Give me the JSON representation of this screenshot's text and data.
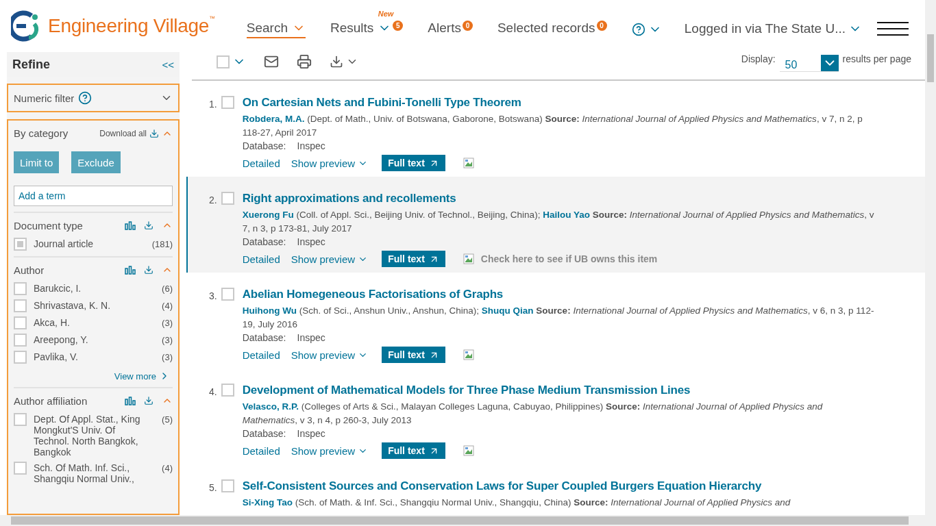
{
  "header": {
    "logo_text": "Engineering Village",
    "logo_mark": "™",
    "account": "Logged in via The State U...",
    "nav": [
      {
        "label": "Search",
        "selected": true
      },
      {
        "label": "Results",
        "selected": false,
        "tag": "New",
        "badge": "5"
      },
      {
        "label": "Alerts",
        "selected": false,
        "badge": "0"
      },
      {
        "label": "Selected records",
        "selected": false,
        "badge": "0"
      }
    ]
  },
  "toolbar": {
    "select_all_checked": false,
    "display_label": "Display:",
    "display_value": "50",
    "per_page": "results per page"
  },
  "sidebar": {
    "title": "Refine",
    "collapse": "<<",
    "numeric_filter": "Numeric filter",
    "category_title": "By category",
    "download_all": "Download all",
    "buttons": [
      "Limit to",
      "Exclude"
    ],
    "term_placeholder": "Add a term",
    "facets": [
      {
        "title": "Document type",
        "expanded": true,
        "items": [
          {
            "label": "Journal article",
            "count": "(181)",
            "checked": true
          }
        ]
      },
      {
        "title": "Author",
        "expanded": true,
        "view_more": "View more",
        "items": [
          {
            "label": "Barukcic, I.",
            "count": "(6)",
            "checked": false
          },
          {
            "label": "Shrivastava, K. N.",
            "count": "(4)",
            "checked": false
          },
          {
            "label": "Akca, H.",
            "count": "(3)",
            "checked": false
          },
          {
            "label": "Areepong, Y.",
            "count": "(3)",
            "checked": false
          },
          {
            "label": "Pavlika, V.",
            "count": "(3)",
            "checked": false
          }
        ]
      },
      {
        "title": "Author affiliation",
        "expanded": true,
        "items": [
          {
            "label": "Dept. Of Appl. Stat., King Mongkut'S Univ. Of Technol. North Bangkok, Bangkok",
            "count": "(5)",
            "checked": false
          },
          {
            "label": "Sch. Of Math. Inf. Sci., Shangqiu Normal Univ.,",
            "count": "(4)",
            "checked": false
          }
        ]
      }
    ]
  },
  "results": [
    {
      "number": "1.",
      "checked": false,
      "highlighted": false,
      "title": "On Cartesian Nets and Fubini-Tonelli Type Theorem",
      "authors": [
        {
          "name": "Robdera, M.A.",
          "affiliation": "(Dept. of Math., Univ. of Botswana, Gaborone, Botswana)"
        }
      ],
      "source_label": "Source:",
      "journal": "International Journal of Applied Physics and Mathematics",
      "details": ", v 7, n 2, p 118-27, April 2017",
      "database_label": "Database:",
      "database": "Inspec",
      "detailed": "Detailed",
      "preview": "Show preview",
      "fulltext": "Full text"
    },
    {
      "number": "2.",
      "checked": false,
      "highlighted": true,
      "title": "Right approximations and recollements",
      "authors": [
        {
          "name": "Xuerong Fu",
          "affiliation": "(Coll. of Appl. Sci., Beijing Univ. of Technol., Beijing, China);"
        },
        {
          "name": "Hailou Yao"
        }
      ],
      "source_label": "Source:",
      "journal": "International Journal of Applied Physics and Mathematics",
      "details": ", v 7, n 3, p 173-81, July 2017",
      "database_label": "Database:",
      "database": "Inspec",
      "detailed": "Detailed",
      "preview": "Show preview",
      "fulltext": "Full text",
      "holdings_link": "Check here to see if UB owns this item"
    },
    {
      "number": "3.",
      "checked": false,
      "highlighted": false,
      "title": "Abelian Homegeneous Factorisations of Graphs",
      "authors": [
        {
          "name": "Huihong Wu",
          "affiliation": "(Sch. of Sci., Anshun Univ., Anshun, China);"
        },
        {
          "name": "Shuqu Qian"
        }
      ],
      "source_label": "Source:",
      "journal": "International Journal of Applied Physics and Mathematics",
      "details": ", v 6, n 3, p 112-19, July 2016",
      "database_label": "Database:",
      "database": "Inspec",
      "detailed": "Detailed",
      "preview": "Show preview",
      "fulltext": "Full text"
    },
    {
      "number": "4.",
      "checked": false,
      "highlighted": false,
      "title": "Development of Mathematical Models for Three Phase Medium Transmission Lines",
      "authors": [
        {
          "name": "Velasco, R.P.",
          "affiliation": "(Colleges of Arts & Sci., Malayan Colleges Laguna, Cabuyao, Philippines)"
        }
      ],
      "source_label": "Source:",
      "journal": "International Journal of Applied Physics and Mathematics",
      "details": ", v 3, n 4, p 260-3, July 2013",
      "database_label": "Database:",
      "database": "Inspec",
      "detailed": "Detailed",
      "preview": "Show preview",
      "fulltext": "Full text"
    },
    {
      "number": "5.",
      "checked": false,
      "highlighted": false,
      "title": "Self-Consistent Sources and Conservation Laws for Super Coupled Burgers Equation Hierarchy",
      "authors": [
        {
          "name": "Si-Xing Tao",
          "affiliation": "(Sch. of Math. & Inf. Sci., Shangqiu Normal Univ., Shangqiu, China)"
        }
      ],
      "source_label": "Source:",
      "journal": "International Journal of Applied Physics and"
    }
  ]
}
